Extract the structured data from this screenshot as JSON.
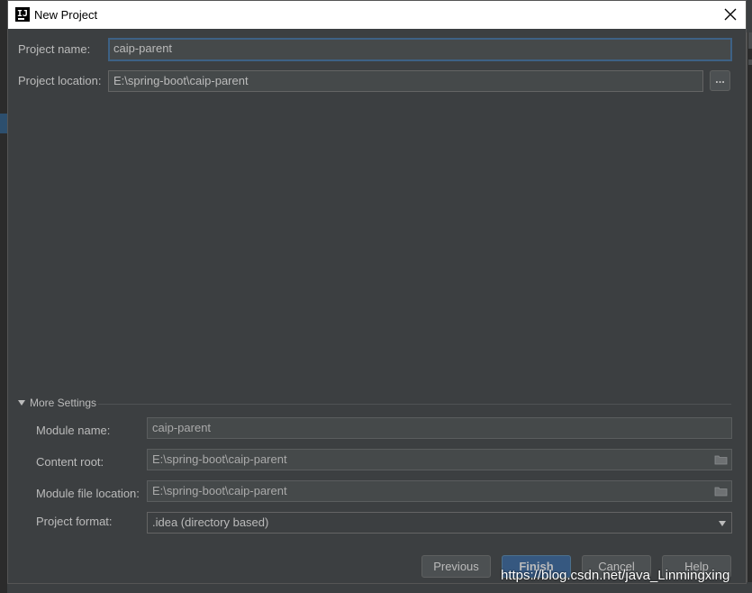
{
  "window": {
    "title": "New Project",
    "icon_name": "intellij-icon"
  },
  "project": {
    "name_label": "Project name:",
    "name_value": "caip-parent",
    "location_label": "Project location:",
    "location_value": "E:\\spring-boot\\caip-parent",
    "browse_label": "..."
  },
  "more_settings": {
    "header": "More Settings",
    "module_name_label": "Module name:",
    "module_name_value": "caip-parent",
    "content_root_label": "Content root:",
    "content_root_value": "E:\\spring-boot\\caip-parent",
    "module_file_label": "Module file location:",
    "module_file_value": "E:\\spring-boot\\caip-parent",
    "format_label": "Project format:",
    "format_value": ".idea (directory based)"
  },
  "buttons": {
    "previous": "Previous",
    "finish": "Finish",
    "cancel": "Cancel",
    "help": "Help"
  },
  "watermark": "https://blog.csdn.net/java_Linmingxing",
  "colors": {
    "background": "#3c3f41",
    "field": "#45494a",
    "focus_border": "#3d6185",
    "default_button": "#365880"
  }
}
